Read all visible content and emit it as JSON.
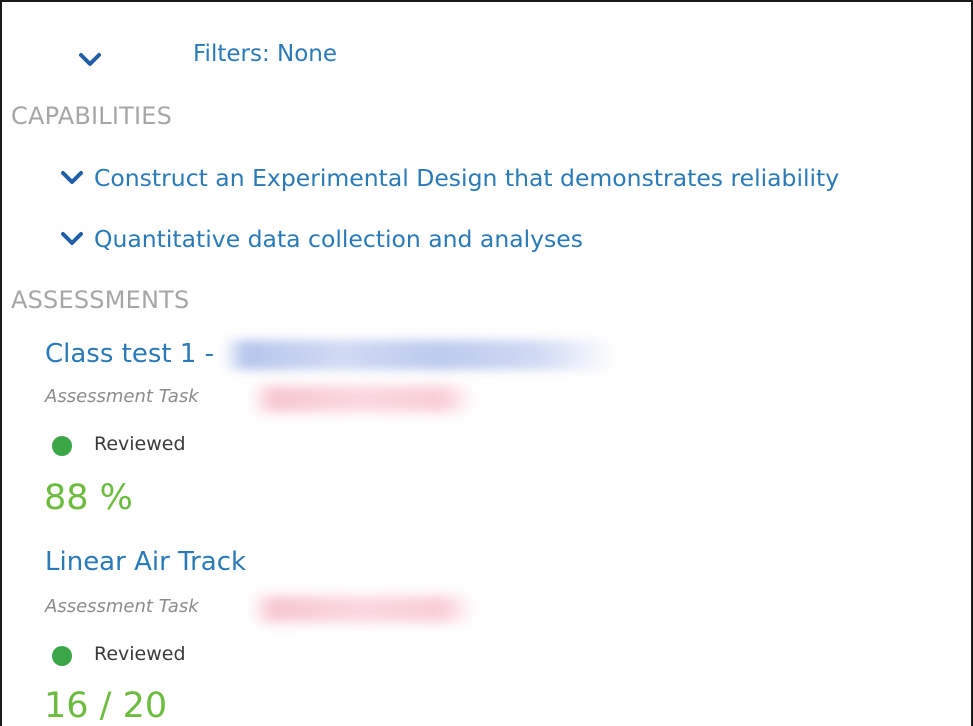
{
  "filters": {
    "label": "Filters: None"
  },
  "capabilities": {
    "heading": "CAPABILITIES",
    "items": [
      {
        "label": "Construct an Experimental Design that demonstrates reliability"
      },
      {
        "label": "Quantitative data collection and analyses"
      }
    ]
  },
  "assessments": {
    "heading": "ASSESSMENTS",
    "items": [
      {
        "title": "Class test 1 -",
        "type": "Assessment Task",
        "status": "Reviewed",
        "score": "88 %"
      },
      {
        "title": "Linear Air Track",
        "type": "Assessment Task",
        "status": "Reviewed",
        "score": "16 / 20"
      }
    ]
  },
  "colors": {
    "link": "#2a7ab8",
    "section_heading": "#a6a6a6",
    "status_reviewed": "#3aa646",
    "score": "#6dbb3f"
  },
  "icons": {
    "filter_toggle": "chevron-down-icon",
    "capability_toggle": "chevron-down-icon",
    "status": "status-dot-icon"
  }
}
